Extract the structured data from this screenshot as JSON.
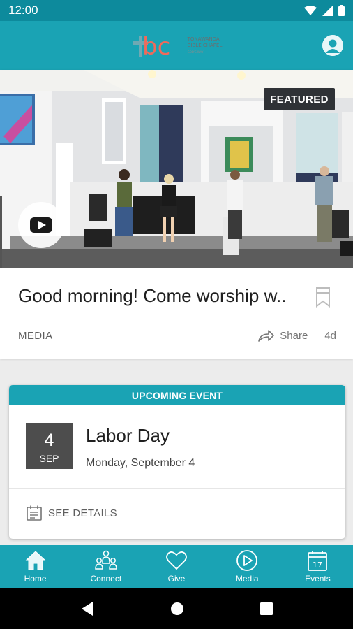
{
  "status_bar": {
    "time": "12:00"
  },
  "app_bar": {
    "logo": {
      "letters": "bc",
      "name_line1": "TONAWANDA",
      "name_line2": "BIBLE CHAPEL",
      "tagline": "GOD'S WAY"
    }
  },
  "featured_post": {
    "badge": "FEATURED",
    "title": "Good morning! Come worship w..",
    "category": "MEDIA",
    "share_label": "Share",
    "age": "4d"
  },
  "event_card": {
    "header": "UPCOMING EVENT",
    "day": "4",
    "month": "SEP",
    "title": "Labor Day",
    "date_text": "Monday, September 4",
    "details_label": "SEE DETAILS"
  },
  "tabs": [
    {
      "label": "Home",
      "icon": "home-icon"
    },
    {
      "label": "Connect",
      "icon": "connect-icon"
    },
    {
      "label": "Give",
      "icon": "heart-icon"
    },
    {
      "label": "Media",
      "icon": "play-icon"
    },
    {
      "label": "Events",
      "icon": "calendar-icon"
    }
  ],
  "calendar_icon_day": "17",
  "colors": {
    "brand": "#1aa3b4",
    "status_bar": "#0d8a9c",
    "date_box": "#4d4d4d"
  }
}
